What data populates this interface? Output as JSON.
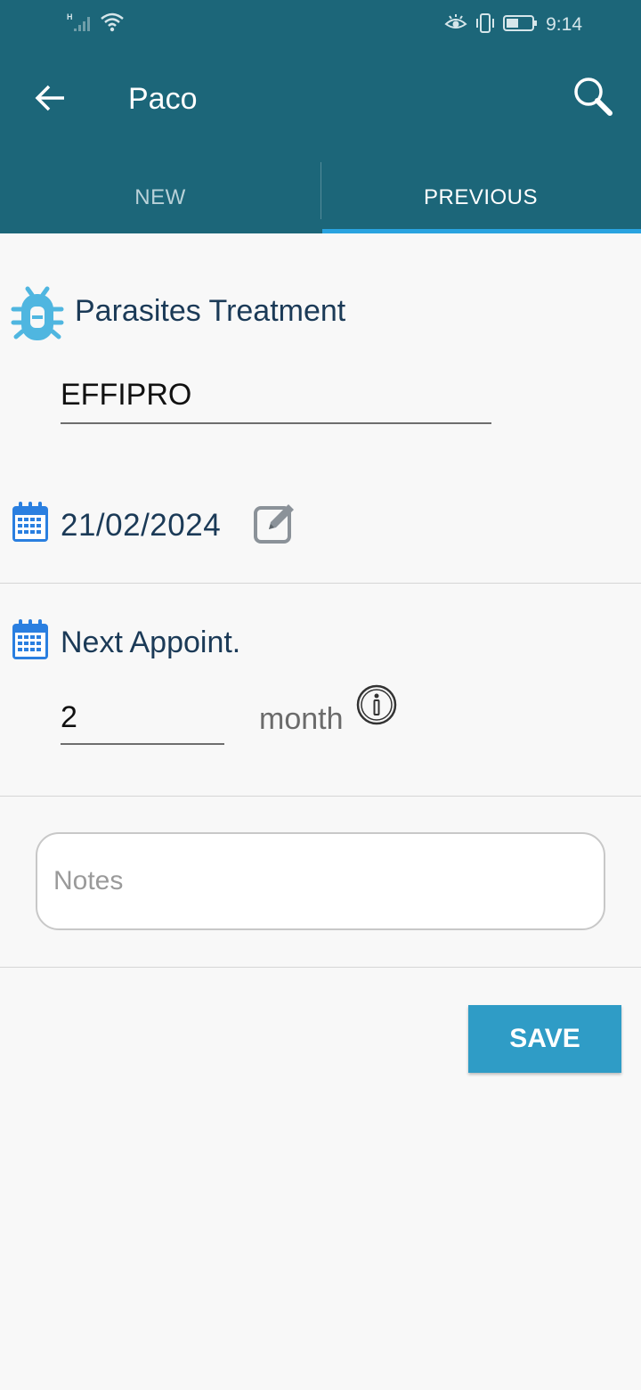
{
  "status_bar": {
    "time": "9:14",
    "network_label": "H",
    "icons": [
      "signal-icon",
      "wifi-icon",
      "eye-icon",
      "vibrate-icon",
      "battery-icon"
    ]
  },
  "app_bar": {
    "title": "Paco",
    "back_icon": "arrow-left-icon",
    "search_icon": "search-icon",
    "background_color": "#1c6679"
  },
  "tabs": [
    {
      "label": "NEW",
      "active": false
    },
    {
      "label": "PREVIOUS",
      "active": true
    }
  ],
  "accent_color": "#29a3e0",
  "treatment": {
    "icon": "bug-icon",
    "title": "Parasites Treatment",
    "value": "EFFIPRO"
  },
  "date": {
    "icon": "calendar-icon",
    "value": "21/02/2024",
    "edit_icon": "edit-icon"
  },
  "next_appointment": {
    "icon": "calendar-icon",
    "title": "Next Appoint.",
    "value": "2",
    "unit": "month",
    "info_icon": "info-icon"
  },
  "notes": {
    "placeholder": "Notes",
    "value": ""
  },
  "save": {
    "label": "SAVE",
    "color": "#2f9cc6"
  }
}
